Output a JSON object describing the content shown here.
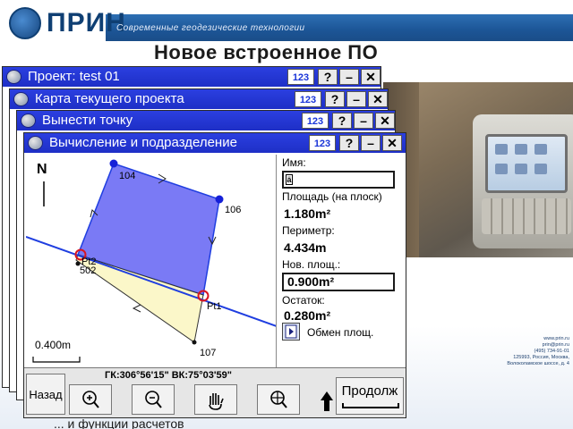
{
  "header": {
    "logo_text": "ПРИН",
    "slogan": "Современные геодезические технологии",
    "slide_title": "Новое встроенное ПО"
  },
  "windows": [
    {
      "title": "Проект: test 01",
      "num_label": "123",
      "help": "?",
      "minimize": "–",
      "close": "✕"
    },
    {
      "title": "Карта текущего проекта",
      "num_label": "123",
      "help": "?",
      "minimize": "–",
      "close": "✕"
    },
    {
      "title": "Вынести точку",
      "num_label": "123",
      "help": "?",
      "minimize": "–",
      "close": "✕"
    },
    {
      "title": "Вычисление и подразделение",
      "num_label": "123",
      "help": "?",
      "minimize": "–",
      "close": "✕"
    }
  ],
  "map": {
    "north": "N",
    "scale": "0.400m",
    "points": {
      "p104": "104",
      "p106": "106",
      "p107": "107",
      "p502": "502",
      "pt1": "Pt1",
      "pt2": "Pt2"
    }
  },
  "panel": {
    "name_label": "Имя:",
    "name_value": "",
    "area_label": "Площадь (на плоск)",
    "area_value": "1.180m²",
    "perimeter_label": "Периметр:",
    "perimeter_value": "4.434m",
    "new_area_label": "Нов. площ.:",
    "new_area_value": "0.900m²",
    "remainder_label": "Остаток:",
    "remainder_value": "0.280m²",
    "swap_label": "Обмен площ."
  },
  "toolbar": {
    "back": "Назад",
    "coords": "ГК:306°56'15\"  ВК:75°03'59\"",
    "next": "Продолж"
  },
  "footer": {
    "contact": [
      "www.prin.ru",
      "prin@prin.ru",
      "(495) 734-91-01",
      "125993, Россия, Москва,",
      "Волоколамское шоссе, д. 4"
    ],
    "caption": "... и функции расчетов"
  },
  "colors": {
    "title_bar": "#1e2fc6",
    "polygon_blue": "#7a7af5",
    "polygon_yellow": "#fbf7c9",
    "division_line": "#1f3ee0"
  }
}
